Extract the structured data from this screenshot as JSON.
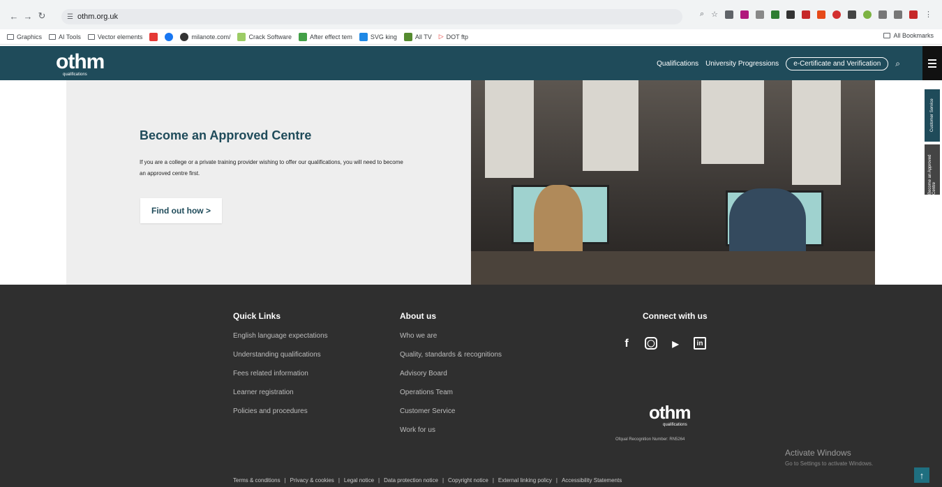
{
  "browser": {
    "url": "othm.org.uk",
    "bookmarks": [
      "Graphics",
      "AI Tools",
      "Vector elements",
      "milanote.com/",
      "Crack Software",
      "After effect tem",
      "SVG king",
      "All TV",
      "DOT ftp"
    ],
    "all_bookmarks": "All Bookmarks"
  },
  "header": {
    "logo": "othm",
    "logo_sub": "qualifications",
    "nav": [
      "Qualifications",
      "University Progressions",
      "e-Certificate and Verification"
    ]
  },
  "hero": {
    "title": "Become an Approved Centre",
    "text": "If you are a college or a private training provider wishing to offer our qualifications, you will need to become an approved centre first.",
    "button": "Find out how >"
  },
  "side_tabs": [
    "Customer Service",
    "Become an Approved Centre"
  ],
  "footer": {
    "quick_links_title": "Quick Links",
    "quick_links": [
      "English language expectations",
      "Understanding qualifications",
      "Fees related information",
      "Learner registration",
      "Policies and procedures"
    ],
    "about_title": "About us",
    "about_links": [
      "Who we are",
      "Quality, standards & recognitions",
      "Advisory Board",
      "Operations Team",
      "Customer Service",
      "Work for us"
    ],
    "connect_title": "Connect with us",
    "logo": "othm",
    "logo_sub": "qualifications",
    "recognition": "Ofqual Recognition Number: RN5264",
    "bottom_links": [
      "Terms & conditions",
      "Privacy & cookies",
      "Legal notice",
      "Data protection notice",
      "Copyright notice",
      "External linking policy",
      "Accessibility Statements"
    ]
  },
  "watermark": {
    "title": "Activate Windows",
    "sub": "Go to Settings to activate Windows."
  },
  "colors": {
    "primary": "#1f4b5a",
    "footer": "#2f2f2f"
  }
}
